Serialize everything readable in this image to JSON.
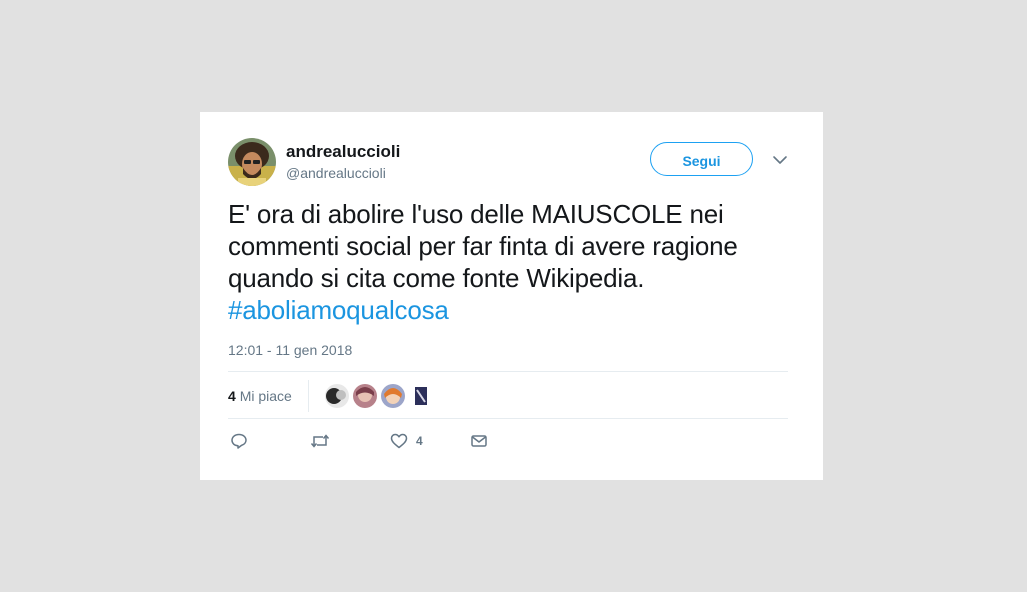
{
  "tweet": {
    "display_name": "andrealuccioli",
    "handle": "@andrealuccioli",
    "follow_label": "Segui",
    "text": "E' ora di abolire l'uso delle MAIUSCOLE nei commenti social per far finta di avere ragione quando si cita come fonte Wikipedia. ",
    "hashtag": "#aboliamoqualcosa",
    "timestamp": "12:01 - 11 gen 2018",
    "likes_count": "4",
    "likes_label": "Mi piace",
    "like_action_count": "4"
  },
  "colors": {
    "link": "#1b95e0",
    "text": "#14171a",
    "muted": "#657786",
    "background": "#e1e1e1"
  },
  "icons": [
    "reply-icon",
    "retweet-icon",
    "heart-icon",
    "message-icon",
    "chevron-down-icon"
  ]
}
